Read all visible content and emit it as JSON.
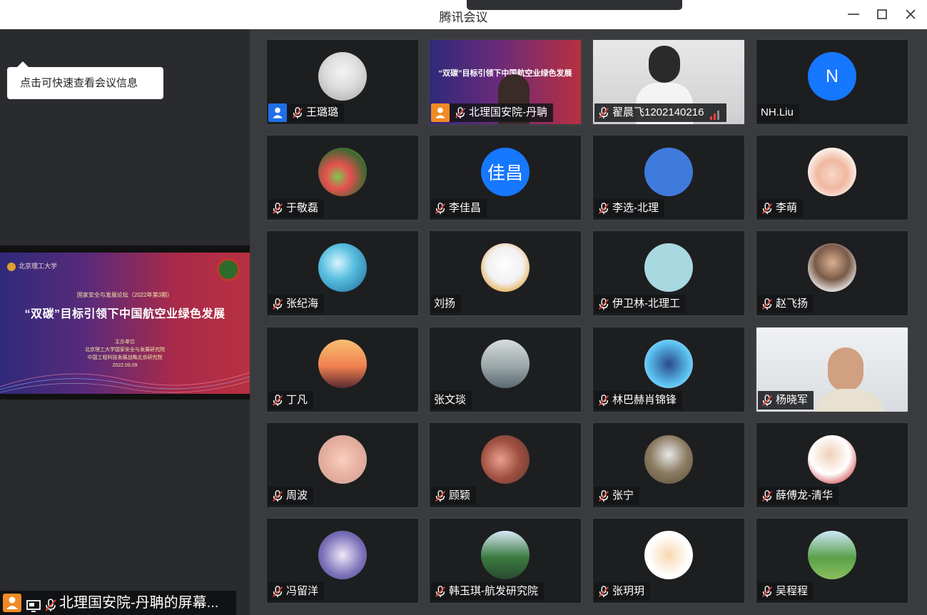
{
  "window": {
    "title": "腾讯会议",
    "minimize_icon": "minimize-icon",
    "maximize_icon": "maximize-icon",
    "close_icon": "close-icon"
  },
  "sidebar": {
    "tooltip": "点击可快速查看会议信息",
    "shared_slide": {
      "school": "北京理工大学",
      "forum": "国家安全与发展论坛（2022年第3期）",
      "headline": "“双碳”目标引领下中国航空业绿色发展",
      "host_title": "主办单位",
      "host_line1": "北京理工大学国家安全与发展研究院",
      "host_line2": "中国工程科技发展战略北京研究院",
      "date": "2022.09.09"
    },
    "presenter_label": "北理国安院-丹聃的屏幕..."
  },
  "participants": [
    {
      "name": "王璐璐",
      "avatar": "snow-tree-photo",
      "muted": true,
      "host": "blue"
    },
    {
      "name": "北理国安院-丹聃",
      "avatar": "video-presenter-slide",
      "muted": true,
      "host": "orange"
    },
    {
      "name": "翟晨飞1202140216",
      "avatar": "video-young-man",
      "muted": true,
      "signal": true
    },
    {
      "name": "NH.Liu",
      "avatar": "N",
      "avatar_color": "#1677ff",
      "muted": false
    },
    {
      "name": "于敬磊",
      "avatar": "kids-playing-photo",
      "muted": true
    },
    {
      "name": "李佳昌",
      "avatar": "佳昌",
      "avatar_color": "#1677ff",
      "muted": true
    },
    {
      "name": "李选-北理",
      "avatar": "",
      "avatar_color": "#3f7bdc",
      "muted": true
    },
    {
      "name": "李萌",
      "avatar": "baby-photo",
      "muted": true
    },
    {
      "name": "张纪海",
      "avatar": "ocean-wave-photo",
      "muted": true
    },
    {
      "name": "刘扬",
      "avatar": "white-dog-photo",
      "muted": false
    },
    {
      "name": "伊卫林-北理工",
      "avatar": "",
      "avatar_color": "#a8d8e0",
      "muted": true
    },
    {
      "name": "赵飞扬",
      "avatar": "man-portrait-photo",
      "muted": true
    },
    {
      "name": "丁凡",
      "avatar": "sunset-silhouette-photo",
      "muted": true
    },
    {
      "name": "张文琰",
      "avatar": "lake-pagoda-photo",
      "muted": false
    },
    {
      "name": "林巴赫肖锦锋",
      "avatar": "batman-cartoon",
      "muted": true
    },
    {
      "name": "杨晓军",
      "avatar": "video-middle-aged-man",
      "muted": true
    },
    {
      "name": "周波",
      "avatar": "baby-hand-photo",
      "muted": true
    },
    {
      "name": "顾颖",
      "avatar": "group-photo",
      "muted": true
    },
    {
      "name": "张宁",
      "avatar": "person-outdoor-photo",
      "muted": true
    },
    {
      "name": "薛傅龙-清华",
      "avatar": "man-flag-photo",
      "muted": true
    },
    {
      "name": "冯留洋",
      "avatar": "cartoon-binoculars",
      "muted": true
    },
    {
      "name": "韩玉琪-航发研究院",
      "avatar": "tree-landscape-photo",
      "muted": true
    },
    {
      "name": "张玥玥",
      "avatar": "cartoon-girl",
      "muted": true
    },
    {
      "name": "吴程程",
      "avatar": "green-tree-photo",
      "muted": true
    }
  ]
}
